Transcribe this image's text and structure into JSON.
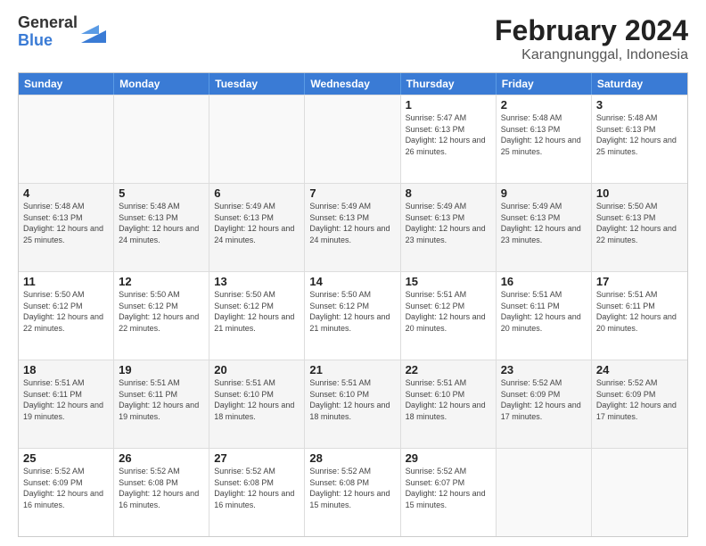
{
  "logo": {
    "general": "General",
    "blue": "Blue"
  },
  "title": "February 2024",
  "subtitle": "Karangnunggal, Indonesia",
  "days": [
    "Sunday",
    "Monday",
    "Tuesday",
    "Wednesday",
    "Thursday",
    "Friday",
    "Saturday"
  ],
  "weeks": [
    [
      {
        "day": "",
        "empty": true
      },
      {
        "day": "",
        "empty": true
      },
      {
        "day": "",
        "empty": true
      },
      {
        "day": "",
        "empty": true
      },
      {
        "day": "1",
        "sunrise": "Sunrise: 5:47 AM",
        "sunset": "Sunset: 6:13 PM",
        "daylight": "Daylight: 12 hours and 26 minutes."
      },
      {
        "day": "2",
        "sunrise": "Sunrise: 5:48 AM",
        "sunset": "Sunset: 6:13 PM",
        "daylight": "Daylight: 12 hours and 25 minutes."
      },
      {
        "day": "3",
        "sunrise": "Sunrise: 5:48 AM",
        "sunset": "Sunset: 6:13 PM",
        "daylight": "Daylight: 12 hours and 25 minutes."
      }
    ],
    [
      {
        "day": "4",
        "sunrise": "Sunrise: 5:48 AM",
        "sunset": "Sunset: 6:13 PM",
        "daylight": "Daylight: 12 hours and 25 minutes."
      },
      {
        "day": "5",
        "sunrise": "Sunrise: 5:48 AM",
        "sunset": "Sunset: 6:13 PM",
        "daylight": "Daylight: 12 hours and 24 minutes."
      },
      {
        "day": "6",
        "sunrise": "Sunrise: 5:49 AM",
        "sunset": "Sunset: 6:13 PM",
        "daylight": "Daylight: 12 hours and 24 minutes."
      },
      {
        "day": "7",
        "sunrise": "Sunrise: 5:49 AM",
        "sunset": "Sunset: 6:13 PM",
        "daylight": "Daylight: 12 hours and 24 minutes."
      },
      {
        "day": "8",
        "sunrise": "Sunrise: 5:49 AM",
        "sunset": "Sunset: 6:13 PM",
        "daylight": "Daylight: 12 hours and 23 minutes."
      },
      {
        "day": "9",
        "sunrise": "Sunrise: 5:49 AM",
        "sunset": "Sunset: 6:13 PM",
        "daylight": "Daylight: 12 hours and 23 minutes."
      },
      {
        "day": "10",
        "sunrise": "Sunrise: 5:50 AM",
        "sunset": "Sunset: 6:13 PM",
        "daylight": "Daylight: 12 hours and 22 minutes."
      }
    ],
    [
      {
        "day": "11",
        "sunrise": "Sunrise: 5:50 AM",
        "sunset": "Sunset: 6:12 PM",
        "daylight": "Daylight: 12 hours and 22 minutes."
      },
      {
        "day": "12",
        "sunrise": "Sunrise: 5:50 AM",
        "sunset": "Sunset: 6:12 PM",
        "daylight": "Daylight: 12 hours and 22 minutes."
      },
      {
        "day": "13",
        "sunrise": "Sunrise: 5:50 AM",
        "sunset": "Sunset: 6:12 PM",
        "daylight": "Daylight: 12 hours and 21 minutes."
      },
      {
        "day": "14",
        "sunrise": "Sunrise: 5:50 AM",
        "sunset": "Sunset: 6:12 PM",
        "daylight": "Daylight: 12 hours and 21 minutes."
      },
      {
        "day": "15",
        "sunrise": "Sunrise: 5:51 AM",
        "sunset": "Sunset: 6:12 PM",
        "daylight": "Daylight: 12 hours and 20 minutes."
      },
      {
        "day": "16",
        "sunrise": "Sunrise: 5:51 AM",
        "sunset": "Sunset: 6:11 PM",
        "daylight": "Daylight: 12 hours and 20 minutes."
      },
      {
        "day": "17",
        "sunrise": "Sunrise: 5:51 AM",
        "sunset": "Sunset: 6:11 PM",
        "daylight": "Daylight: 12 hours and 20 minutes."
      }
    ],
    [
      {
        "day": "18",
        "sunrise": "Sunrise: 5:51 AM",
        "sunset": "Sunset: 6:11 PM",
        "daylight": "Daylight: 12 hours and 19 minutes."
      },
      {
        "day": "19",
        "sunrise": "Sunrise: 5:51 AM",
        "sunset": "Sunset: 6:11 PM",
        "daylight": "Daylight: 12 hours and 19 minutes."
      },
      {
        "day": "20",
        "sunrise": "Sunrise: 5:51 AM",
        "sunset": "Sunset: 6:10 PM",
        "daylight": "Daylight: 12 hours and 18 minutes."
      },
      {
        "day": "21",
        "sunrise": "Sunrise: 5:51 AM",
        "sunset": "Sunset: 6:10 PM",
        "daylight": "Daylight: 12 hours and 18 minutes."
      },
      {
        "day": "22",
        "sunrise": "Sunrise: 5:51 AM",
        "sunset": "Sunset: 6:10 PM",
        "daylight": "Daylight: 12 hours and 18 minutes."
      },
      {
        "day": "23",
        "sunrise": "Sunrise: 5:52 AM",
        "sunset": "Sunset: 6:09 PM",
        "daylight": "Daylight: 12 hours and 17 minutes."
      },
      {
        "day": "24",
        "sunrise": "Sunrise: 5:52 AM",
        "sunset": "Sunset: 6:09 PM",
        "daylight": "Daylight: 12 hours and 17 minutes."
      }
    ],
    [
      {
        "day": "25",
        "sunrise": "Sunrise: 5:52 AM",
        "sunset": "Sunset: 6:09 PM",
        "daylight": "Daylight: 12 hours and 16 minutes."
      },
      {
        "day": "26",
        "sunrise": "Sunrise: 5:52 AM",
        "sunset": "Sunset: 6:08 PM",
        "daylight": "Daylight: 12 hours and 16 minutes."
      },
      {
        "day": "27",
        "sunrise": "Sunrise: 5:52 AM",
        "sunset": "Sunset: 6:08 PM",
        "daylight": "Daylight: 12 hours and 16 minutes."
      },
      {
        "day": "28",
        "sunrise": "Sunrise: 5:52 AM",
        "sunset": "Sunset: 6:08 PM",
        "daylight": "Daylight: 12 hours and 15 minutes."
      },
      {
        "day": "29",
        "sunrise": "Sunrise: 5:52 AM",
        "sunset": "Sunset: 6:07 PM",
        "daylight": "Daylight: 12 hours and 15 minutes."
      },
      {
        "day": "",
        "empty": true
      },
      {
        "day": "",
        "empty": true
      }
    ]
  ]
}
